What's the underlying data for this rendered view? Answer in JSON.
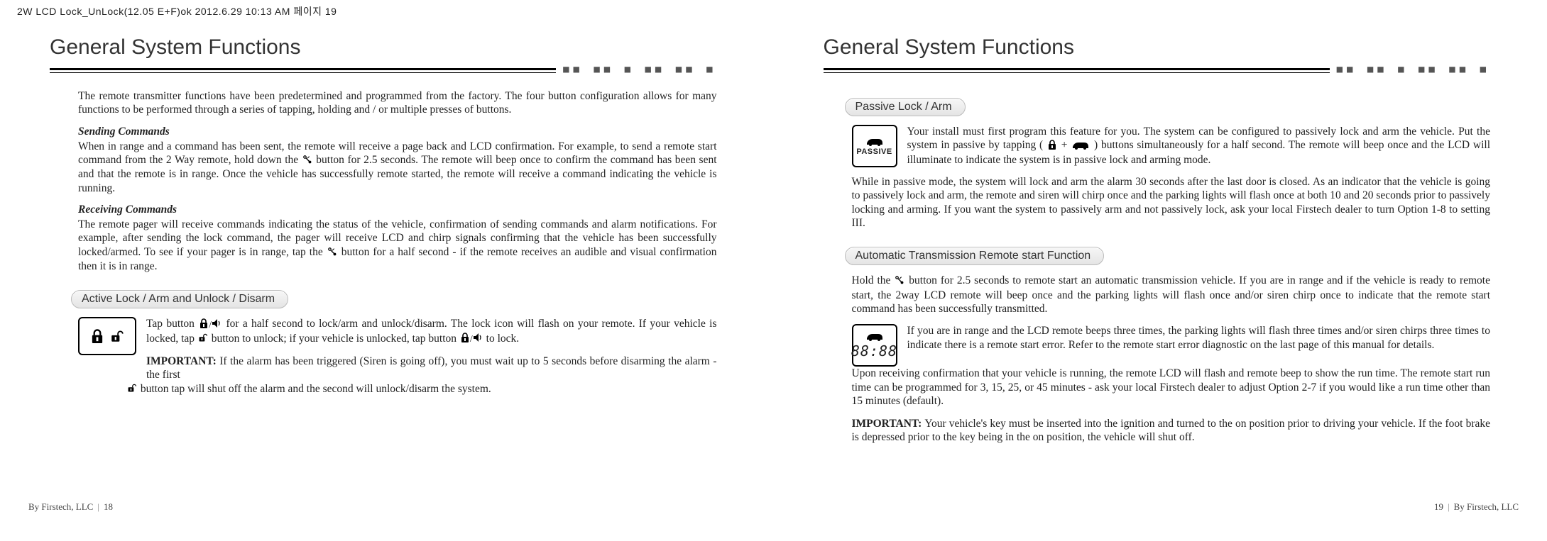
{
  "header_meta": "2W LCD Lock_UnLock(12.05 E+F)ok  2012.6.29 10:13 AM  페이지 19",
  "left": {
    "title": "General System Functions",
    "intro": "The remote transmitter functions have been predetermined and programmed from the factory. The four button configuration allows for many functions to be performed through a series of tapping, holding and / or multiple presses of buttons.",
    "sub1_head": "Sending Commands",
    "sub1_body_a": "When in range and a command has been sent, the remote will receive a page back and LCD confirmation. For example, to send a remote start command from the 2 Way remote, hold down the ",
    "sub1_body_b": " button for 2.5 seconds. The remote will beep once to confirm the command has been sent and that the remote is in range. Once the vehicle has successfully remote started, the remote will receive a command indicating the vehicle is running.",
    "sub2_head": "Receiving Commands",
    "sub2_body_a": "The remote pager will receive commands indicating the status of the vehicle, confirmation of sending commands and alarm notifications. For example, after sending the lock command, the pager will receive LCD and chirp signals confirming that the vehicle has been successfully locked/armed. To see if your pager is in range, tap the ",
    "sub2_body_b": " button for a half second -  if the remote receives an audible and visual confirmation then it is in range.",
    "tab": "Active Lock / Arm and Unlock / Disarm",
    "para1_a": "Tap button ",
    "para1_b": " for a half second to lock/arm and unlock/disarm. The lock icon will flash on your remote. If your vehicle is locked, tap ",
    "para1_c": " button  to unlock; if your vehicle is unlocked, tap button ",
    "para1_d": " to lock.",
    "para2_imp": "IMPORTANT:  ",
    "para2_a": "If the alarm has been triggered (Siren is going off), you must wait up to 5 seconds before disarming the alarm -  the first ",
    "para2_b": " button tap will shut off the alarm and the second will unlock/disarm the system.",
    "footer_brand": "By Firstech, LLC",
    "footer_page": "18"
  },
  "right": {
    "title": "General System Functions",
    "tab1": "Passive Lock / Arm",
    "passive_label": "PASSIVE",
    "p1_a": "Your install must first program this feature for you. The system can be configured to passively lock and arm the vehicle. Put the system in passive by tapping  ( ",
    "p1_plus": " + ",
    "p1_b": " ) buttons  simultaneously for a half second. The remote will beep once and the LCD will illuminate to indicate the system is in passive lock and arming mode.",
    "p2": "While in passive mode, the system will lock and arm the alarm 30 seconds after the last door is closed.  As an indicator that the vehicle is going to passively lock and arm, the remote and siren will chirp once and the parking lights will flash once at both 10 and 20 seconds prior to passively locking and arming. If you want the system to passively arm and not passively lock, ask your local Firstech dealer to turn Option 1-8 to setting III.",
    "tab2": "Automatic Transmission Remote start Function",
    "p3_a": "Hold the ",
    "p3_b": " button for 2.5 seconds to remote start an automatic transmission vehicle. If you are in range and if the vehicle is ready to remote start, the 2way LCD remote will beep once and the parking lights will flash once and/or siren chirp once to indicate that the remote start command has been successfully transmitted.",
    "timer_digits": "88:88",
    "p4": "If you are in range and the LCD remote beeps three times, the parking lights will flash three times and/or siren chirps three times to indicate there is a remote start error. Refer to the  remote start error diagnostic  on the last page of this manual for details.",
    "p5": "Upon receiving confirmation that your vehicle is running, the remote LCD will flash and remote beep to show the run time. The remote start run time can be programmed for 3, 15, 25, or 45 minutes - ask your local Firstech dealer to adjust Option 2-7 if you would like a run time other than 15 minutes (default).",
    "p6_imp": "IMPORTANT:  ",
    "p6": "Your vehicle's key must be inserted into the ignition and turned to the  on  position prior to driving your vehicle. If the foot brake is depressed prior to the key being in the  on  position, the vehicle will shut off.",
    "footer_brand": "By Firstech, LLC",
    "footer_page": "19"
  }
}
